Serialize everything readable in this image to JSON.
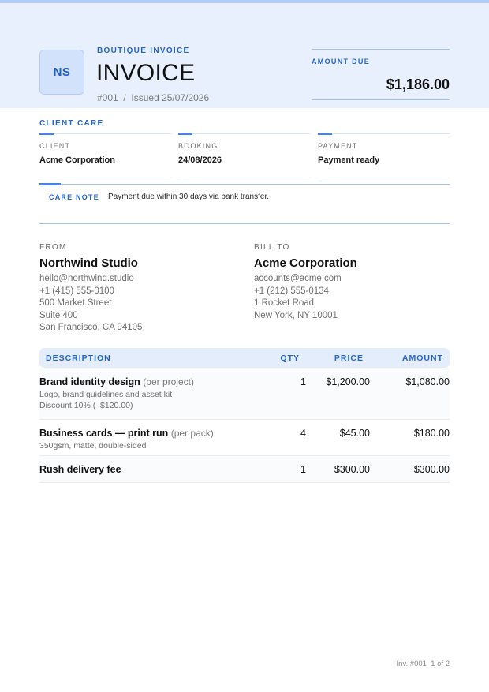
{
  "header": {
    "logo_initials": "NS",
    "eyebrow": "BOUTIQUE INVOICE",
    "title": "INVOICE",
    "number": "#001",
    "separator": "/",
    "issued": "Issued 25/07/2026",
    "amount_due_label": "AMOUNT DUE",
    "amount_due": "$1,186.00"
  },
  "client_care": {
    "title": "CLIENT CARE",
    "fields": [
      {
        "label": "CLIENT",
        "value": "Acme Corporation"
      },
      {
        "label": "BOOKING",
        "value": "24/08/2026"
      },
      {
        "label": "PAYMENT",
        "value": "Payment ready"
      }
    ],
    "note_label": "CARE NOTE",
    "note_text": "Payment due within 30 days via bank transfer."
  },
  "from": {
    "label": "FROM",
    "name": "Northwind Studio",
    "lines": [
      "hello@northwind.studio",
      "+1 (415) 555-0100",
      "500 Market Street",
      "Suite 400",
      "San Francisco, CA 94105"
    ]
  },
  "bill_to": {
    "label": "BILL TO",
    "name": "Acme Corporation",
    "lines": [
      "accounts@acme.com",
      "+1 (212) 555-0134",
      "1 Rocket Road",
      "New York, NY 10001"
    ]
  },
  "table": {
    "headers": {
      "description": "DESCRIPTION",
      "qty": "QTY",
      "price": "PRICE",
      "amount": "AMOUNT"
    },
    "rows": [
      {
        "description": "Brand identity design",
        "unit": "(per project)",
        "details": [
          "Logo, brand guidelines and asset kit",
          "Discount 10% (–$120.00)"
        ],
        "qty": "1",
        "price": "$1,200.00",
        "amount": "$1,080.00"
      },
      {
        "description": "Business cards — print run",
        "unit": "(per pack)",
        "details": [
          "350gsm, matte, double-sided"
        ],
        "qty": "4",
        "price": "$45.00",
        "amount": "$180.00"
      },
      {
        "description": "Rush delivery fee",
        "unit": "",
        "details": [],
        "qty": "1",
        "price": "$300.00",
        "amount": "$300.00"
      }
    ]
  },
  "footer": {
    "invoice_ref": "Inv. #001",
    "page": "1 of 2"
  }
}
